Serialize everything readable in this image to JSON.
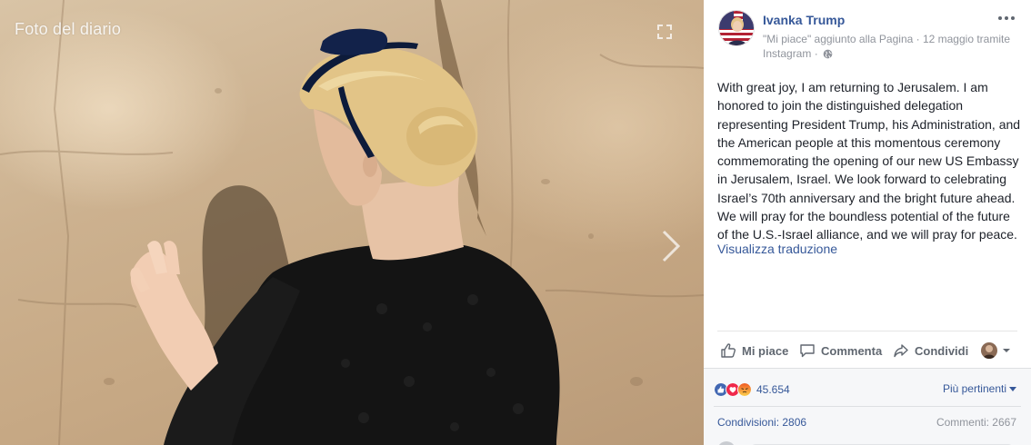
{
  "photo": {
    "label": "Foto del diario",
    "icons": {
      "expand": "expand-icon",
      "next": "chevron-right-icon"
    }
  },
  "post": {
    "author": "Ivanka Trump",
    "meta": "\"Mi piace\" aggiunto alla Pagina · 12 maggio tramite Instagram ·",
    "text": "With great joy, I am returning to Jerusalem. I am honored to join the distinguished delegation representing President Trump, his Administration, and the American people at this momentous ceremony commemorating the opening of our new US Embassy in Jerusalem, Israel. We look forward to celebrating Israel’s 70th anniversary and the bright future ahead. We will pray for the boundless potential of the future of the U.S.-Israel alliance, and we will pray for peace.",
    "translate_link": "Visualizza traduzione"
  },
  "actions": {
    "like": "Mi piace",
    "comment": "Commenta",
    "share": "Condividi"
  },
  "stats": {
    "reaction_count": "45.654",
    "sort_label": "Più pertinenti",
    "shares": "Condivisioni: 2806",
    "comments": "Commenti: 2667"
  },
  "colors": {
    "link_blue": "#365899",
    "text": "#1d2129",
    "meta_gray": "#90949c",
    "action_gray": "#606770",
    "stats_bg": "#f6f7f9"
  }
}
